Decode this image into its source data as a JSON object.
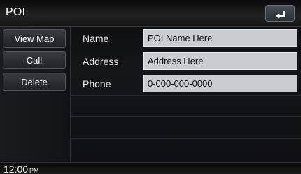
{
  "window": {
    "title": "POI"
  },
  "titlebar": {
    "back_icon": "back-arrow-icon"
  },
  "sidebar": {
    "items": [
      {
        "label": "View Map"
      },
      {
        "label": "Call"
      },
      {
        "label": "Delete"
      }
    ]
  },
  "details": {
    "fields": [
      {
        "label": "Name",
        "value": "POI Name Here"
      },
      {
        "label": "Address",
        "value": "Address Here"
      },
      {
        "label": "Phone",
        "value": "0-000-000-0000"
      }
    ]
  },
  "status": {
    "time": "12:00",
    "ampm": "PM"
  },
  "colors": {
    "accent": "#c9cdd2",
    "background": "#121316",
    "text": "#ffffff"
  }
}
